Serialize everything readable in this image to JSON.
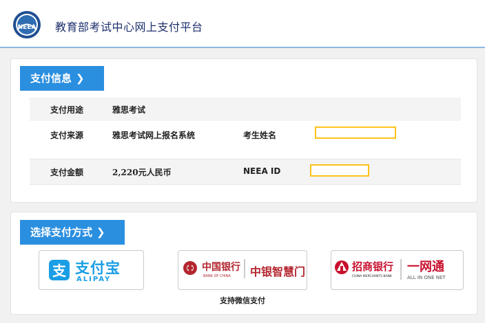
{
  "header": {
    "logo_text": "NEEA",
    "site_title": "教育部考试中心网上支付平台"
  },
  "payment_info": {
    "heading": "支付信息",
    "rows": [
      {
        "label": "支付用途",
        "value": "雅思考试"
      },
      {
        "label": "支付来源",
        "value": "雅思考试网上报名系统",
        "extra_label": "考生姓名"
      },
      {
        "label": "支付金额",
        "value": "2,220元人民币",
        "extra_label": "NEEA ID"
      }
    ]
  },
  "payment_method": {
    "heading": "选择支付方式",
    "alipay": {
      "cn": "支付宝",
      "en": "ALIPAY"
    },
    "boc": {
      "cn": "中国银行",
      "en": "BANK OF CHINA",
      "sub": "中银智慧门"
    },
    "cmb": {
      "cn": "招商银行",
      "en": "CHINA MERCHANTS BANK",
      "sub": "一网通",
      "sub_en": "ALL IN ONE NET"
    },
    "wechat_caption": "支持微信支付"
  },
  "colors": {
    "accent_blue": "#2b8fe0",
    "highlight_yellow": "#ffc21a",
    "title_navy": "#1c2f6b",
    "boc_red": "#b3262e",
    "cmb_red": "#c8102e"
  }
}
